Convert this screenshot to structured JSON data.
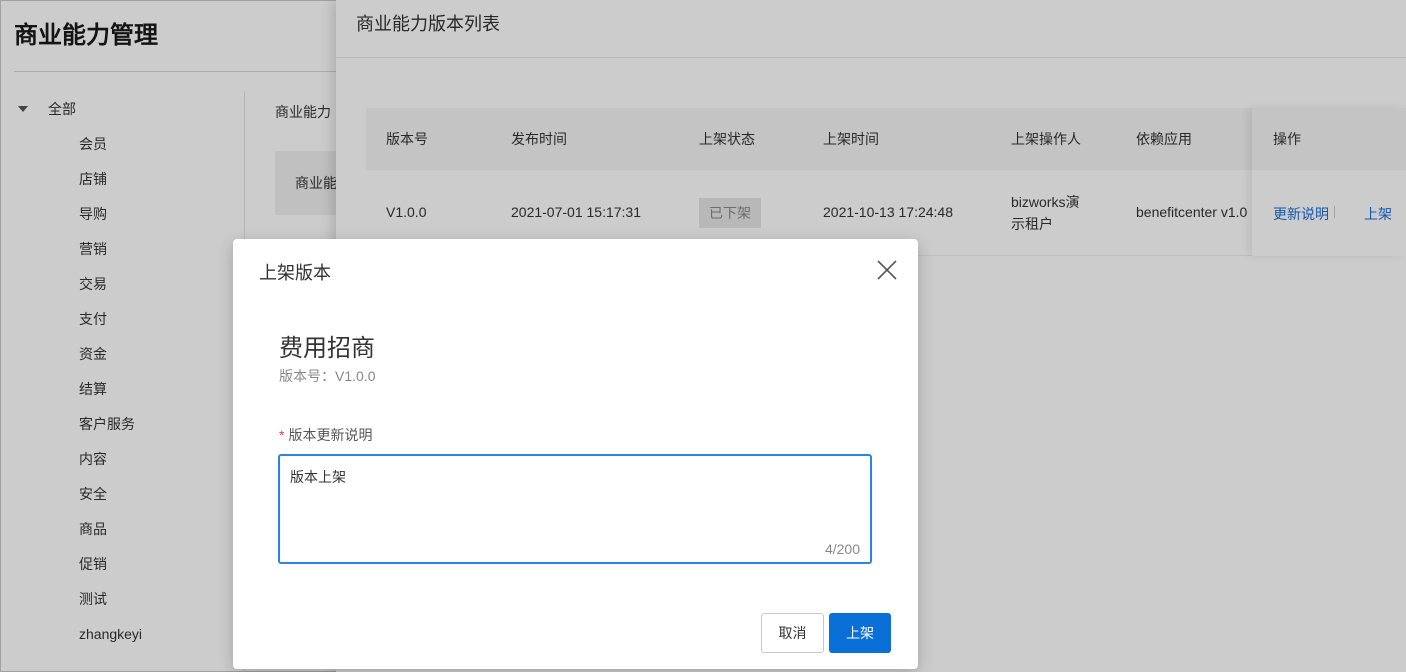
{
  "page": {
    "title": "商业能力管理",
    "tree": {
      "root": "全部",
      "items": [
        "会员",
        "店铺",
        "导购",
        "营销",
        "交易",
        "支付",
        "资金",
        "结算",
        "客户服务",
        "内容",
        "安全",
        "商品",
        "促销",
        "测试",
        "zhangkeyi"
      ]
    },
    "middle": {
      "header": "商业能力",
      "card": "商业能"
    }
  },
  "drawer": {
    "title": "商业能力版本列表",
    "table": {
      "headers": [
        "版本号",
        "发布时间",
        "上架状态",
        "上架时间",
        "上架操作人",
        "依赖应用",
        "操作"
      ],
      "rows": [
        {
          "version": "V1.0.0",
          "publish_time": "2021-07-01 15:17:31",
          "status": "已下架",
          "shelf_time": "2021-10-13 17:24:48",
          "operator_line1": "bizworks演",
          "operator_line2": "示租户",
          "dependency": "benefitcenter v1.0",
          "action_notes": "更新说明",
          "action_shelf": "上架"
        }
      ]
    }
  },
  "modal": {
    "title": "上架版本",
    "name": "费用招商",
    "version_label": "版本号：",
    "version_value": "V1.0.0",
    "field_label": "版本更新说明",
    "field_value": "版本上架",
    "counter": "4/200",
    "cancel_label": "取消",
    "confirm_label": "上架"
  },
  "colors": {
    "primary": "#0a6fd6",
    "link": "#1a6fd6",
    "required": "#e63c3c",
    "focus_border": "#2b83ea"
  },
  "icons": {
    "close": "close-icon",
    "tree_caret": "caret-down-icon"
  }
}
